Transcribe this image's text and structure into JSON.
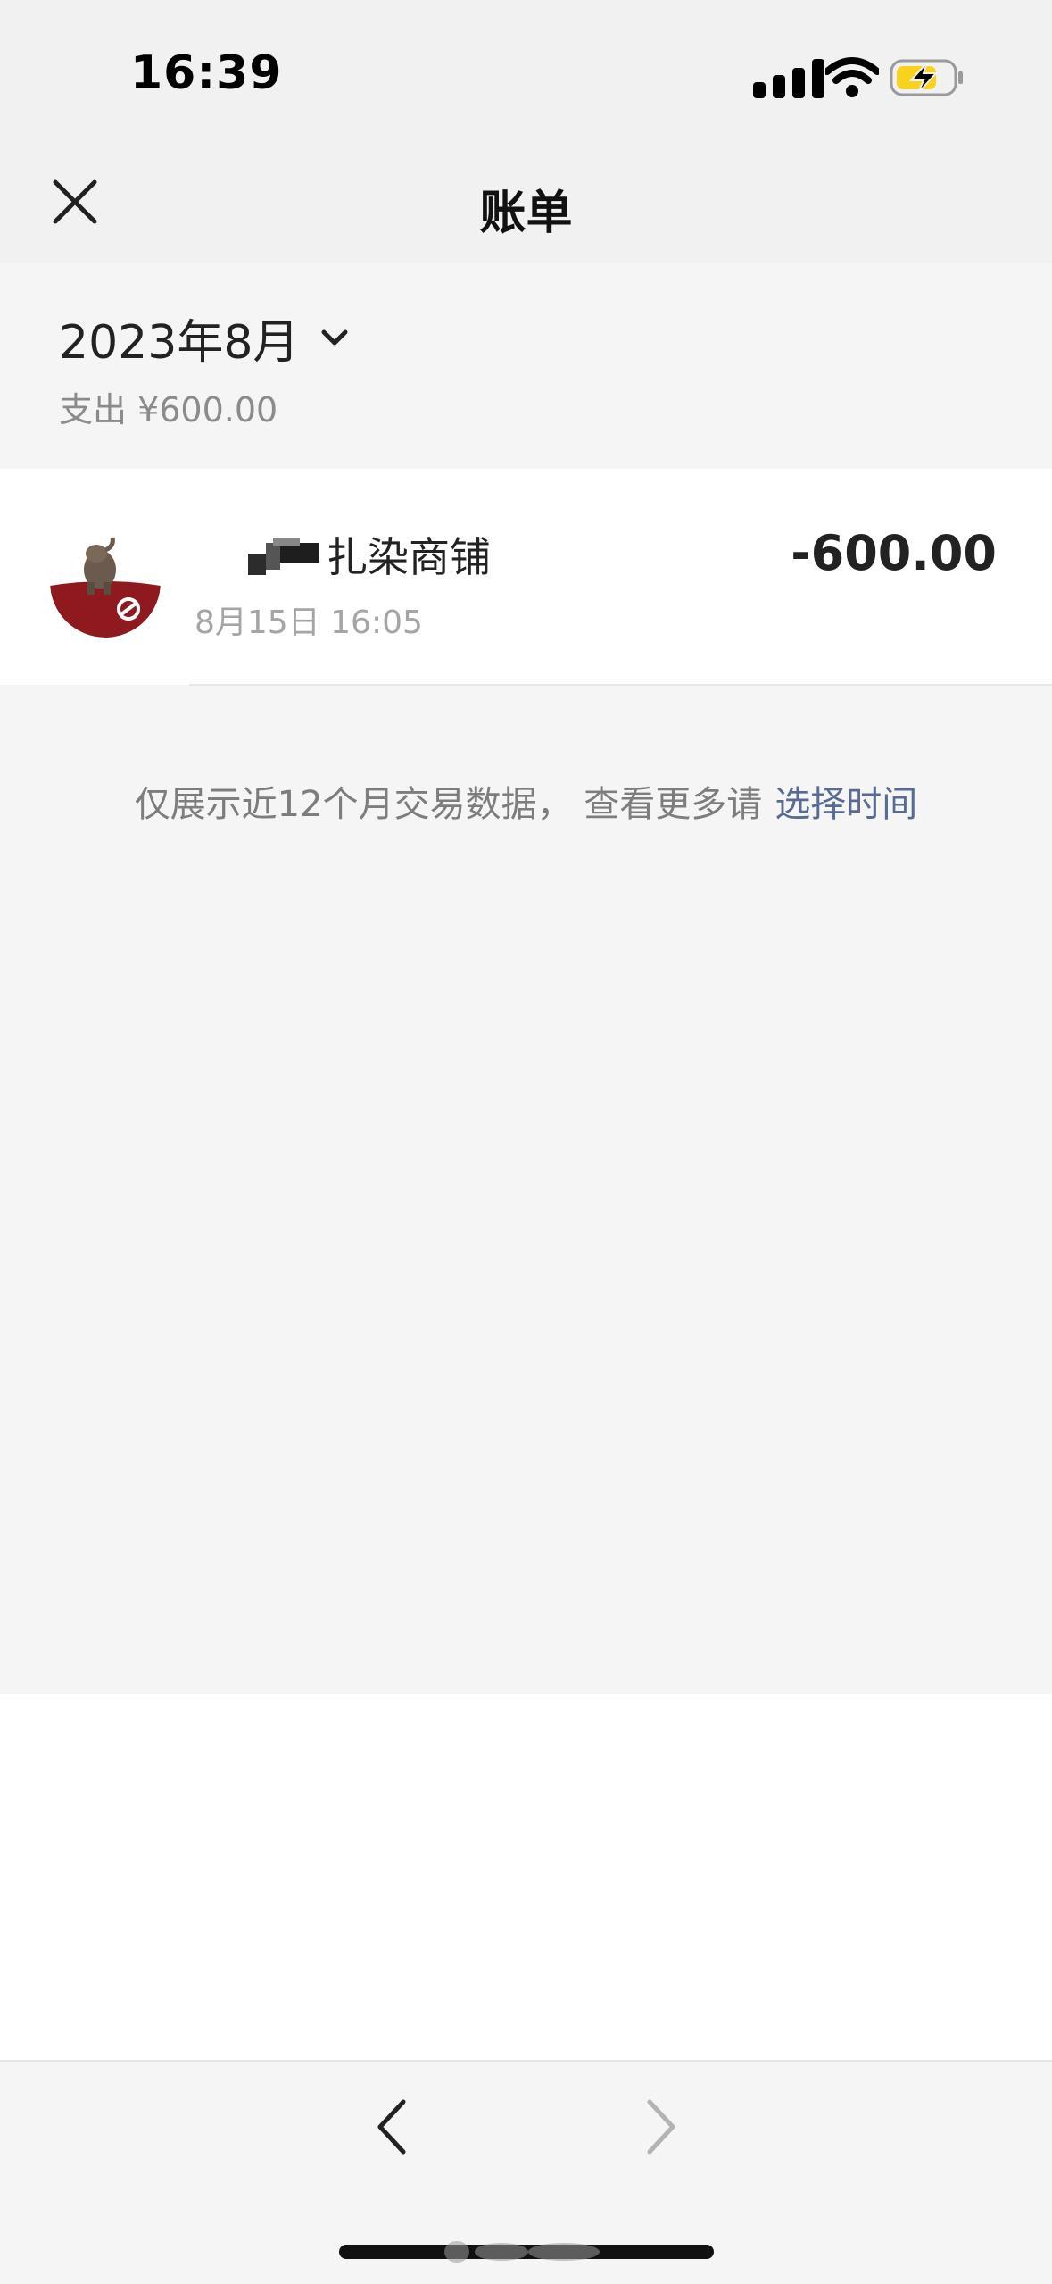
{
  "status_bar": {
    "time": "16:39",
    "signal_icon": "cellular-signal-icon",
    "wifi_icon": "wifi-icon",
    "battery_icon": "battery-charging-icon",
    "battery_color": "#f8d21c"
  },
  "nav": {
    "title": "账单",
    "close_icon": "close-icon"
  },
  "month": {
    "label": "2023年8月",
    "dropdown_icon": "chevron-down-icon",
    "expense_summary": "支出 ¥600.00"
  },
  "transactions": [
    {
      "merchant": "扎染商铺",
      "datetime": "8月15日 16:05",
      "amount": "-600.00",
      "avatar_icon": "elephant-logo-avatar"
    }
  ],
  "notice": {
    "text": "仅展示近12个月交易数据， 查看更多请",
    "link": "选择时间",
    "link_color": "#576b95"
  },
  "toolbar": {
    "back_icon": "chevron-left-icon",
    "forward_icon": "chevron-right-icon"
  }
}
